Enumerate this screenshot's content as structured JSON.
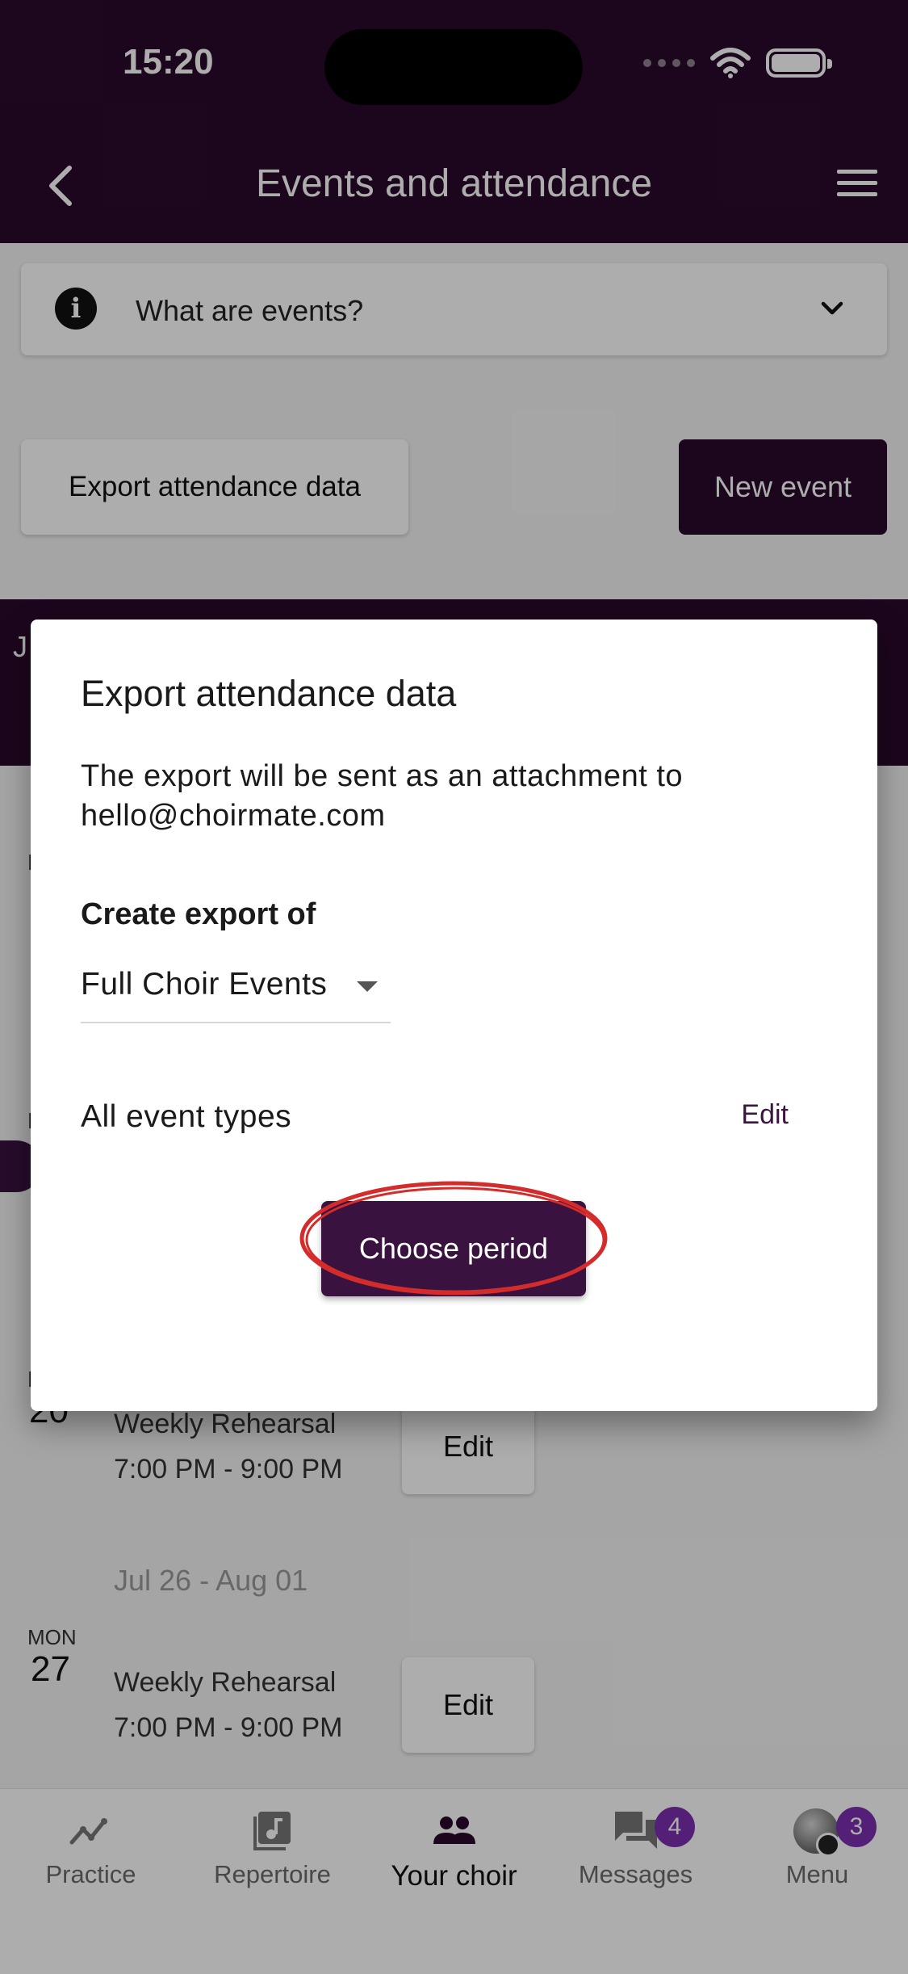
{
  "status_bar": {
    "time": "15:20"
  },
  "app_bar": {
    "title": "Events and attendance"
  },
  "info_card": {
    "label": "What are events?"
  },
  "actions": {
    "export_label": "Export attendance data",
    "new_event_label": "New event"
  },
  "month_bar": {
    "initial": "J"
  },
  "stray_letters": [
    "M",
    "M",
    "M"
  ],
  "events": [
    {
      "dow": "",
      "day": "20",
      "title": "Weekly Rehearsal",
      "time": "7:00 PM - 9:00 PM",
      "edit_label": "Edit"
    },
    {
      "dow": "MON",
      "day": "27",
      "title": "Weekly Rehearsal",
      "time": "7:00 PM - 9:00 PM",
      "edit_label": "Edit"
    }
  ],
  "week_range": "Jul 26 - Aug 01",
  "bottom_nav": [
    {
      "label": "Practice",
      "icon": "trend-icon"
    },
    {
      "label": "Repertoire",
      "icon": "music-note-icon"
    },
    {
      "label": "Your choir",
      "icon": "people-icon",
      "active": true
    },
    {
      "label": "Messages",
      "icon": "chat-icon",
      "badge": "4"
    },
    {
      "label": "Menu",
      "icon": "avatar",
      "badge": "3"
    }
  ],
  "dialog": {
    "title": "Export attendance data",
    "body": "The export will be sent as an attachment to hello@choirmate.com",
    "section_label": "Create export of",
    "select_value": "Full Choir Events",
    "event_types": "All event types",
    "edit_label": "Edit",
    "choose_button": "Choose period"
  },
  "colors": {
    "primary": "#2a0a2c",
    "button": "#3a1240",
    "badge": "#7b2fb0",
    "highlight": "#d42b2b"
  }
}
